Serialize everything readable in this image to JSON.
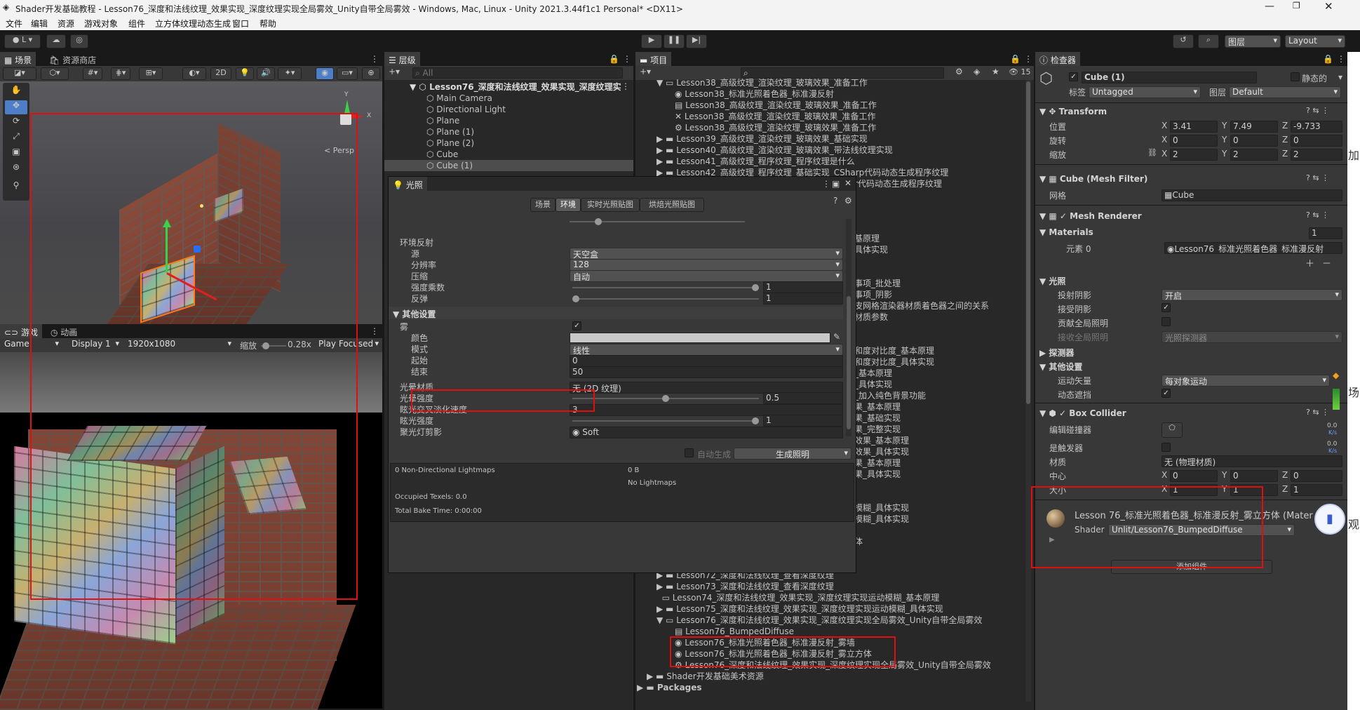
{
  "window": {
    "title": "Shader开发基础教程 - Lesson76_深度和法线纹理_效果实现_深度纹理实现全局雾效_Unity自带全局雾效 - Windows, Mac, Linux - Unity 2021.3.44f1c1 Personal* <DX11>"
  },
  "menu": [
    "文件",
    "编辑",
    "资源",
    "游戏对象",
    "组件",
    "立方体纹理动态生成",
    "窗口",
    "帮助"
  ],
  "toolbar": {
    "layers": "图层",
    "layout": "Layout"
  },
  "scene": {
    "tab_scene": "场景",
    "tab_store": "资源商店",
    "mode2d": "2D",
    "persp": "< Persp"
  },
  "game": {
    "tab_game": "游戏",
    "tab_anim": "动画",
    "game": "Game",
    "display": "Display 1",
    "res": "1920x1080",
    "scale_label": "缩放",
    "scale": "0.28x",
    "play": "Play Focused"
  },
  "hierarchy": {
    "tab": "层级",
    "search": "All",
    "root": "Lesson76_深度和法线纹理_效果实现_深度纹理实",
    "items": [
      "Main Camera",
      "Directional Light",
      "Plane",
      "Plane (1)",
      "Plane (2)",
      "Cube",
      "Cube (1)"
    ]
  },
  "project": {
    "tab": "项目",
    "count": "15",
    "top": [
      "Lesson38_高级纹理_渲染纹理_玻璃效果_准备工作",
      "Lesson38_标准光照着色器_标准漫反射",
      "Lesson38_高级纹理_渲染纹理_玻璃效果_准备工作",
      "Lesson38_高级纹理_渲染纹理_玻璃效果_准备工作",
      "Lesson38_高级纹理_渲染纹理_玻璃效果_准备工作",
      "Lesson39_高级纹理_渲染纹理_玻璃效果_基础实现",
      "Lesson40_高级纹理_渲染纹理_玻璃效果_带法线纹理实现",
      "Lesson41_高级纹理_程序纹理_程序纹理是什么",
      "Lesson42_高级纹理_程序纹理_基础实现_CSharp代码动态生成程序纹理",
      "r代码动态生成程序纹理"
    ],
    "mid": [
      "基原理",
      "具体实现",
      "事项_批处理",
      "事项_阴影",
      "皮网格渲染器材质着色器之间的关系",
      "材质参数",
      "和度对比度_基本原理",
      "和度对比度_具体实现",
      "_基本原理",
      "_具体实现",
      "_加入纯色背景功能",
      "果_基本原理",
      "果_基础实现",
      "果_完整实现",
      "效果_基本原理",
      "效果_具体实现",
      "果_基本原理",
      "果_具体实现",
      "模糊_具体实现",
      "模糊_具体实现",
      "体"
    ],
    "bottom": [
      "Lesson72_深度和法线纹理_查看深度纹理",
      "Lesson73_深度和法线纹理_查看深度纹理",
      "Lesson74_深度和法线纹理_效果实现_深度纹理实现运动模糊_基本原理",
      "Lesson75_深度和法线纹理_效果实现_深度纹理实现运动模糊_具体实现",
      "Lesson76_深度和法线纹理_效果实现_深度纹理实现全局雾效_Unity自带全局雾效",
      "Lesson76_BumpedDiffuse",
      "Lesson76_标准光照着色器_标准漫反射_雾墙",
      "Lesson76_标准光照着色器_标准漫反射_雾立方体",
      "Lesson76_深度和法线纹理_效果实现_深度纹理实现全局雾效_Unity自带全局雾效",
      "Shader开发基础美术资源",
      "Packages"
    ]
  },
  "lighting": {
    "title": "光照",
    "tabs": [
      "场景",
      "环境",
      "实时光照贴图",
      "烘焙光照贴图"
    ],
    "env_refl": "环境反射",
    "rows": [
      {
        "label": "源",
        "value": "天空盒"
      },
      {
        "label": "分辨率",
        "value": "128"
      },
      {
        "label": "压缩",
        "value": "自动"
      }
    ],
    "intensity": {
      "label": "强度乘数",
      "value": "1"
    },
    "bounce": {
      "label": "反弹",
      "value": "1"
    },
    "other": "其他设置",
    "fog": "雾",
    "fog_color": "颜色",
    "fog_mode": "模式",
    "fog_mode_val": "线性",
    "fog_start": "起始",
    "fog_start_val": "0",
    "fog_end": "结束",
    "fog_end_val": "50",
    "halo_tex": "光晕材质",
    "halo_tex_val": "无 (2D 纹理)",
    "halo_str": "光晕强度",
    "halo_str_val": "0.5",
    "flare_fade": "眩光交叉淡化速度",
    "flare_fade_val": "3",
    "flare_str": "眩光强度",
    "flare_str_val": "1",
    "spot": "聚光灯剪影",
    "spot_val": "Soft",
    "auto": "自动生成",
    "gen": "生成照明",
    "stats": [
      "0 Non-Directional Lightmaps",
      "0 B",
      "No Lightmaps",
      "Occupied Texels: 0.0",
      "Total Bake Time: 0:00:00"
    ]
  },
  "inspector": {
    "tab": "检查器",
    "name": "Cube (1)",
    "static": "静态的",
    "tag_l": "标签",
    "tag": "Untagged",
    "layer_l": "图层",
    "layer": "Default",
    "transform": "Transform",
    "pos": "位置",
    "rot": "旋转",
    "scl": "缩放",
    "px": "3.41",
    "py": "7.49",
    "pz": "-9.733",
    "rx": "0",
    "ry": "0",
    "rz": "0",
    "sx": "2",
    "sy": "2",
    "sz": "2",
    "mf": "Cube (Mesh Filter)",
    "mesh_l": "网格",
    "mesh": "Cube",
    "mr": "Mesh Renderer",
    "materials": "Materials",
    "mat_count": "1",
    "elem": "元素 0",
    "elem_val": "Lesson76_标准光照着色器_标准漫反射",
    "light": "光照",
    "cast": "投射阴影",
    "cast_val": "开启",
    "recv": "接受阴影",
    "gi": "贡献全局照明",
    "recv_gi": "接收全局照明",
    "recv_gi_val": "光照探测器",
    "probes": "探测器",
    "other": "其他设置",
    "motion": "运动矢量",
    "motion_val": "每对象运动",
    "dyn": "动态遮挡",
    "bc": "Box Collider",
    "edit": "编辑碰撞器",
    "trig": "是触发器",
    "mat": "材质",
    "mat_val": "无 (物理材质)",
    "center": "中心",
    "size": "大小",
    "cx": "0",
    "cy": "0",
    "cz": "0",
    "zx": "1",
    "zy": "1",
    "zz": "1",
    "matname": "Lesson 76_标准光照着色器_标准漫反射_雾立方体 (Mater",
    "shader_l": "Shader",
    "shader": "Unlit/Lesson76_BumpedDiffuse",
    "add": "添加组件",
    "kbs1": "0.0",
    "kbs1u": "K/s",
    "kbs2": "0.0",
    "kbs2u": "K/s"
  },
  "axes": {
    "x": "X",
    "y": "Y",
    "z": "Z"
  },
  "edge": [
    "加",
    "场",
    "观"
  ]
}
